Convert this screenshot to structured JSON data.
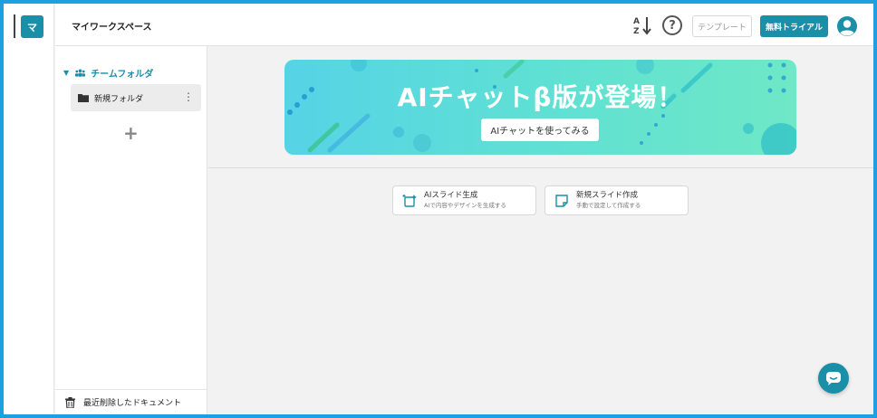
{
  "workspace": {
    "badge": "マ",
    "title": "マイワークスペース"
  },
  "header": {
    "help_label": "?",
    "template_label": "テンプレート",
    "trial_label": "無料トライアル"
  },
  "sidebar": {
    "team_folder_label": "チームフォルダ",
    "folders": [
      {
        "label": "新規フォルダ"
      }
    ],
    "add_label": "+",
    "trash_label": "最近削除したドキュメント"
  },
  "banner": {
    "title": "AIチャットβ版が登場！",
    "button_label": "AIチャットを使ってみる"
  },
  "cards": [
    {
      "title": "AIスライド生成",
      "subtitle": "AIで内容やデザインを生成する",
      "icon": "ai-slide-icon"
    },
    {
      "title": "新規スライド作成",
      "subtitle": "手動で設定して作成する",
      "icon": "new-slide-icon"
    }
  ],
  "colors": {
    "accent": "#1b8ea8",
    "frame": "#1ea0e0",
    "background": "#f2f2f2"
  }
}
